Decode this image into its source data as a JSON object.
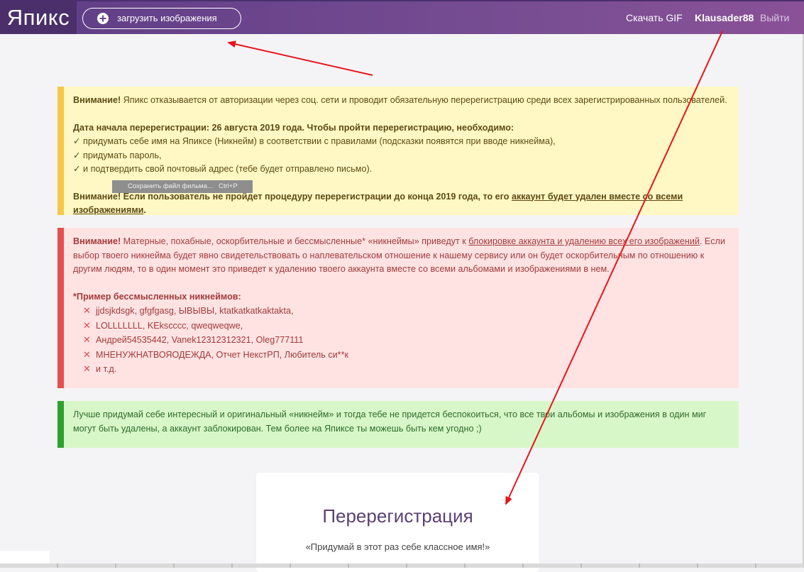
{
  "header": {
    "logo": "Япикс",
    "upload_label": "загрузить изображения",
    "nav_gif": "Скачать GIF",
    "nav_user": "Klausader88",
    "nav_logout": "Выйти"
  },
  "alert_yellow": {
    "attention": "Внимание!",
    "line1": " Япикс отказывается от авторизации через соц. сети и проводит обязательную перерегистрацию среди всех зарегистрированных пользователей.",
    "date_line": "Дата начала перерегистрации: 26 августа 2019 года. Чтобы пройти перерегистрацию, необходимо:",
    "step1": "✓ придумать себе имя на Япиксе (Никнейм) в соответствии с правилами (подсказки появятся при вводе никнейма),",
    "step2": "✓ придумать пароль,",
    "step3": "✓ и подтвердить свой почтовый адрес (тебе будет отправлено письмо).",
    "warning_start": "Внимание! Если пользователь не пройдет процедуру перерегистрации до конца 2019 года, то его ",
    "warning_link": "аккаунт будет удален вместе со всеми изображениями",
    "warning_end": "."
  },
  "tooltip": {
    "text": "Сохранить файл фильма...",
    "shortcut": "Ctrl+P"
  },
  "alert_red": {
    "attention": "Внимание!",
    "text_start": " Матерные, похабные, оскорбительные и бессмысленные* «никнеймы» приведут к ",
    "link": "блокировке аккаунта и удалению всех его изображений",
    "text_end": ". Если выбор твоего никнейма будет явно свидетельствовать о наплевательском отношение к нашему сервису или он будет оскорбительным по отношению к другим людям, то в один момент это приведет к удалению твоего аккаунта вместе со всеми альбомами и изображениями в нем.",
    "examples_title": "*Пример бессмысленных никнеймов:",
    "examples": [
      "jjdsjkdsgk, gfgfgasg, ЫВЫВЫ, ktatkatkatkaktakta,",
      "LOLLLLLLL, KEkscccc, qweqweqwe,",
      "Андрей54535442, Vanek12312312321, Oleg777111",
      "МНЕНУЖНАТВОЯОДЕЖДА, Отчет НекстРП, Любитель си**к",
      "и т.д."
    ],
    "x_glyph": "✕"
  },
  "alert_green": {
    "text": "Лучше придумай себе интересный и оригинальный «никнейм» и тогда тебе не придется беспокоиться, что все твои альбомы и изображения в один миг могут быть удалены, а аккаунт заблокирован. Тем более на Япиксе ты можешь быть кем угодно ;)"
  },
  "card": {
    "title": "Перерегистрация",
    "subtitle": "«Придумай в этот раз себе классное имя!»"
  },
  "colors": {
    "header_start": "#5e3d86",
    "header_end": "#8a5197",
    "annotation_arrow": "#e8141c"
  }
}
